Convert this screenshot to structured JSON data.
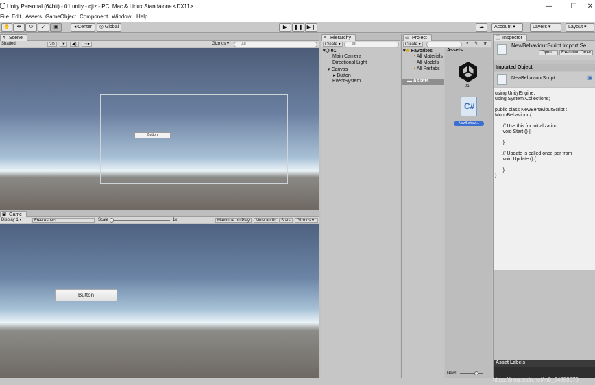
{
  "window": {
    "title": "Unity Personal (64bit) - 01.unity - cjtz - PC, Mac & Linux Standalone <DX11>",
    "minimize": "—",
    "maximize": "☐",
    "close": "✕"
  },
  "menu": [
    "File",
    "Edit",
    "Assets",
    "GameObject",
    "Component",
    "Window",
    "Help"
  ],
  "toolbar": {
    "pivot_label": "Center",
    "space_label": "Global",
    "account_label": "Account",
    "layers_label": "Layers",
    "layout_label": "Layout"
  },
  "scene": {
    "tab": "Scene",
    "shading": "Shaded",
    "mode_2d": "2D",
    "gizmos": "Gizmos",
    "search_placeholder": "All",
    "button_text": "Button"
  },
  "game": {
    "tab": "Game",
    "display": "Display 1",
    "aspect": "Free Aspect",
    "scale_label": "Scale",
    "scale_value": "1x",
    "maximize": "Maximize on Play",
    "mute": "Mute audio",
    "stats": "Stats",
    "gizmos": "Gizmos",
    "button_text": "Button"
  },
  "hierarchy": {
    "tab": "Hierarchy",
    "create": "Create",
    "search_placeholder": "All",
    "scene": "01",
    "items": [
      "Main Camera",
      "Directional Light",
      "Canvas",
      "Button",
      "EventSystem"
    ]
  },
  "project": {
    "tab": "Project",
    "create": "Create",
    "favorites": "Favorites",
    "favorite_items": [
      "All Materials",
      "All Models",
      "All Prefabs"
    ],
    "assets_folder": "Assets",
    "assets_header": "Assets",
    "asset_items": [
      {
        "label": "01",
        "icon": "unity-logo-icon"
      },
      {
        "label": "NewBehavi...",
        "icon": "csharp-script-icon"
      }
    ],
    "new_label": "New!"
  },
  "inspector": {
    "tab": "Inspector",
    "title": "NewBehaviourScript Import Se",
    "open": "Open...",
    "exec_order": "Execution Order",
    "imported_header": "Imported Object",
    "script_name": "NewBehaviourScript",
    "code": "using UnityEngine;\nusing System.Collections;\n\npublic class NewBehaviourScript :\nMonoBehaviour {\n\n\t// Use this for initialization\n\tvoid Start () {\n\t\n\t}\n\t\n\t// Update is called once per fram\n\tvoid Update () {\n\t\n\t}\n}",
    "asset_labels": "Asset Labels"
  },
  "watermark": "https://blog.csdn.net/m0_54888070",
  "colors": {
    "selection": "#3d6fd1",
    "panel": "#c2c2c2",
    "code_bg": "#f0f0f0"
  }
}
